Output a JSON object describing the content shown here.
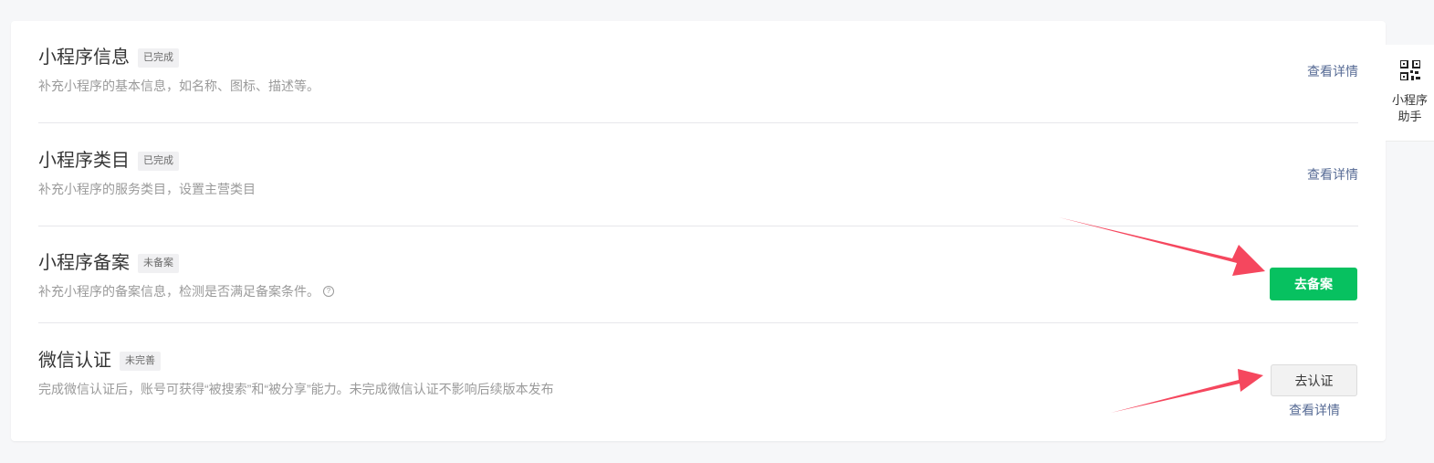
{
  "rows": [
    {
      "title": "小程序信息",
      "badge": "已完成",
      "desc": "补充小程序的基本信息，如名称、图标、描述等。",
      "action": "查看详情"
    },
    {
      "title": "小程序类目",
      "badge": "已完成",
      "desc": "补充小程序的服务类目，设置主营类目",
      "action": "查看详情"
    },
    {
      "title": "小程序备案",
      "badge": "未备案",
      "desc": "补充小程序的备案信息，检测是否满足备案条件。",
      "action": "去备案"
    },
    {
      "title": "微信认证",
      "badge": "未完善",
      "desc": "完成微信认证后，账号可获得“被搜索”和“被分享”能力。未完成微信认证不影响后续版本发布",
      "action": "去认证",
      "secondary_action": "查看详情"
    }
  ],
  "side_helper": {
    "label_line1": "小程序",
    "label_line2": "助手",
    "icon": "qr-code-icon"
  },
  "colors": {
    "primary": "#07c160",
    "link": "#576b95",
    "arrow": "#f5475e"
  }
}
